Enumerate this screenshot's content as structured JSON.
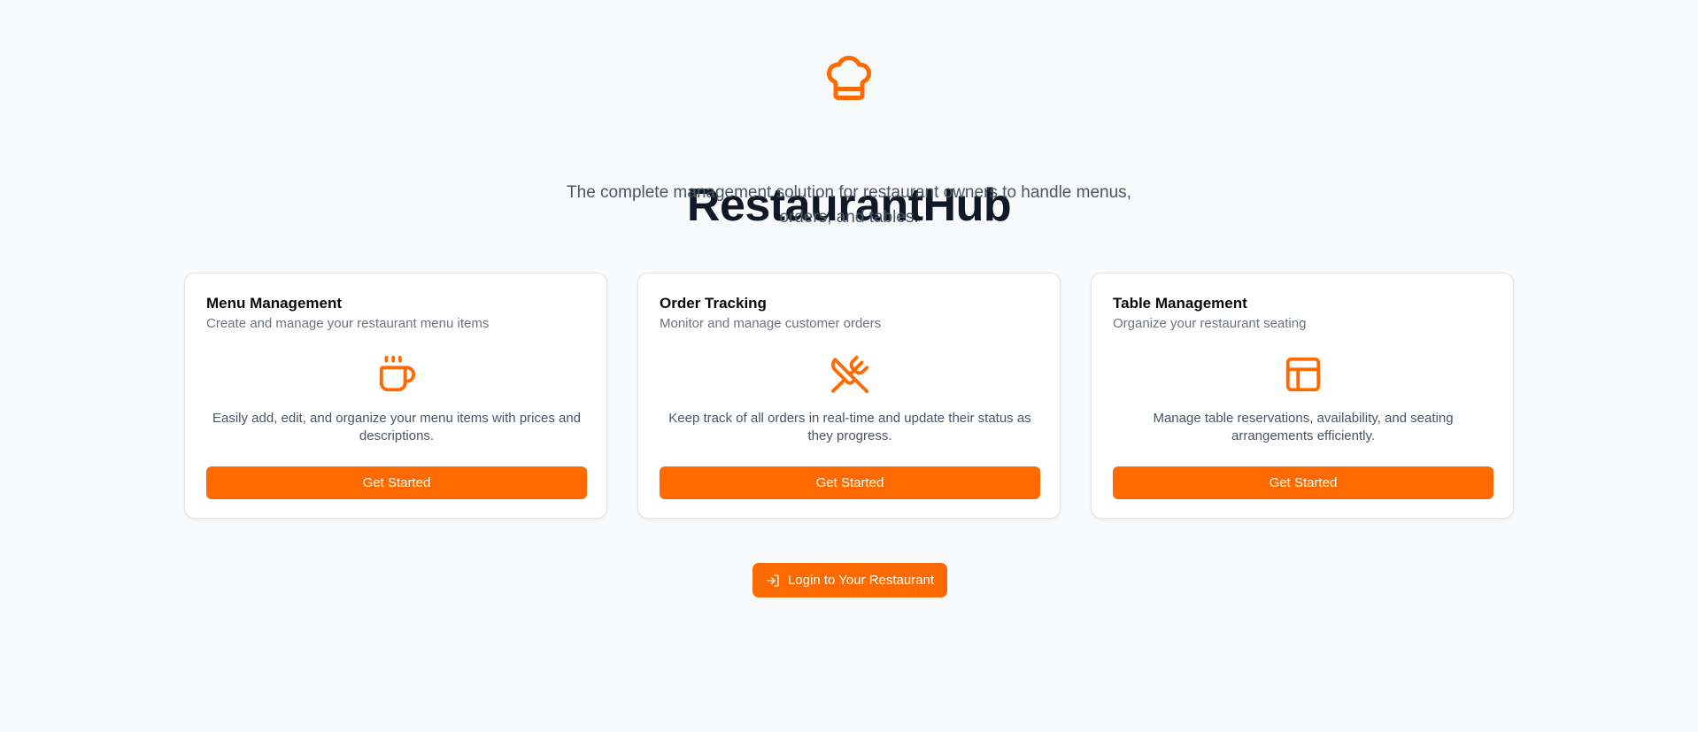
{
  "hero": {
    "logo_icon": "chef-hat-icon",
    "title": "RestaurantHub",
    "subtitle": "The complete management solution for restaurant owners to handle menus, orders, and tables."
  },
  "accent_color": "#ff6a00",
  "cards": [
    {
      "title": "Menu Management",
      "subtitle": "Create and manage your restaurant menu items",
      "icon": "coffee-cup-icon",
      "description": "Easily add, edit, and organize your menu items with prices and descriptions.",
      "button_label": "Get Started"
    },
    {
      "title": "Order Tracking",
      "subtitle": "Monitor and manage customer orders",
      "icon": "utensils-crossed-icon",
      "description": "Keep track of all orders in real-time and update their status as they progress.",
      "button_label": "Get Started"
    },
    {
      "title": "Table Management",
      "subtitle": "Organize your restaurant seating",
      "icon": "layout-icon",
      "description": "Manage table reservations, availability, and seating arrangements efficiently.",
      "button_label": "Get Started"
    }
  ],
  "login": {
    "icon": "log-in-icon",
    "label": "Login to Your Restaurant"
  }
}
